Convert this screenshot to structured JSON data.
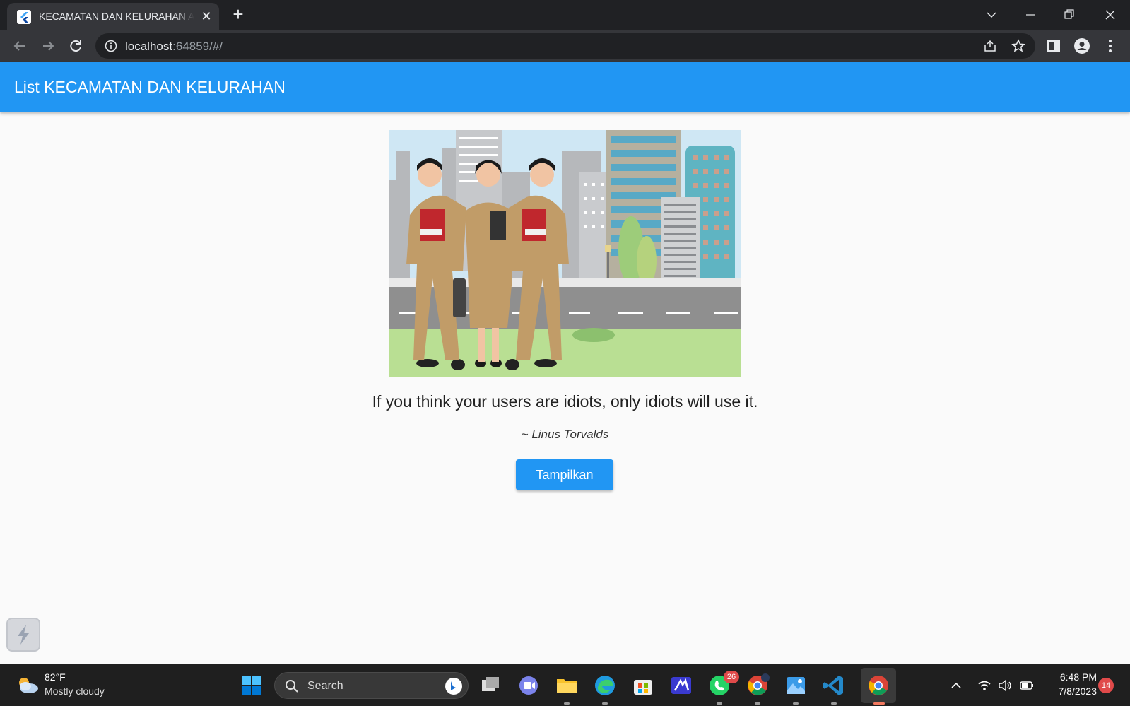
{
  "browser": {
    "tab_title": "KECAMATAN DAN KELURAHAN APP",
    "url_host": "localhost",
    "url_rest": ":64859/#/"
  },
  "app": {
    "title": "List KECAMATAN DAN KELURAHAN",
    "quote": "If you think your users are idiots, only idiots will use it.",
    "author": "~ Linus Torvalds",
    "button_label": "Tampilkan",
    "accent_color": "#2196f3"
  },
  "taskbar": {
    "weather_temp": "82°F",
    "weather_desc": "Mostly cloudy",
    "search_placeholder": "Search",
    "whatsapp_badge": "26",
    "time": "6:48 PM",
    "date": "7/8/2023",
    "notification_count": "14"
  }
}
